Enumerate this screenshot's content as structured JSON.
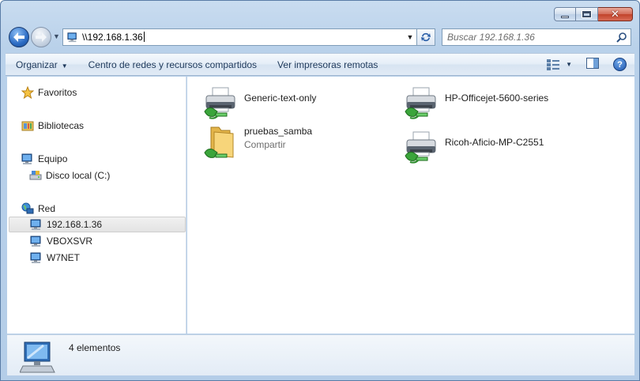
{
  "window": {
    "minimize_icon": "minimize-icon",
    "maximize_icon": "maximize-icon",
    "close_icon": "close-icon"
  },
  "navbar": {
    "back_icon": "back-arrow-icon",
    "forward_icon": "forward-arrow-icon",
    "address": "\\\\192.168.1.36",
    "search_placeholder": "Buscar 192.168.1.36"
  },
  "toolbar": {
    "organize": "Organizar",
    "network_center": "Centro de redes y recursos compartidos",
    "remote_printers": "Ver impresoras remotas",
    "views_icon": "views-icon",
    "preview_icon": "preview-pane-icon",
    "help": "?"
  },
  "sidebar": {
    "favorites": "Favoritos",
    "libraries": "Bibliotecas",
    "computer": "Equipo",
    "local_disk": "Disco local (C:)",
    "network": "Red",
    "hosts": [
      "192.168.1.36",
      "VBOXSVR",
      "W7NET"
    ]
  },
  "content": {
    "items": [
      {
        "name": "Generic-text-only",
        "type": "printer"
      },
      {
        "name": "HP-Officejet-5600-series",
        "type": "printer"
      },
      {
        "name": "pruebas_samba",
        "type": "shared-folder",
        "subtitle": "Compartir"
      },
      {
        "name": "Ricoh-Aficio-MP-C2551",
        "type": "printer"
      }
    ]
  },
  "details": {
    "count_text": "4 elementos"
  },
  "colors": {
    "accent": "#1e395b",
    "window_frame": "#b9d1ea",
    "selection": "#e3e3e3"
  }
}
